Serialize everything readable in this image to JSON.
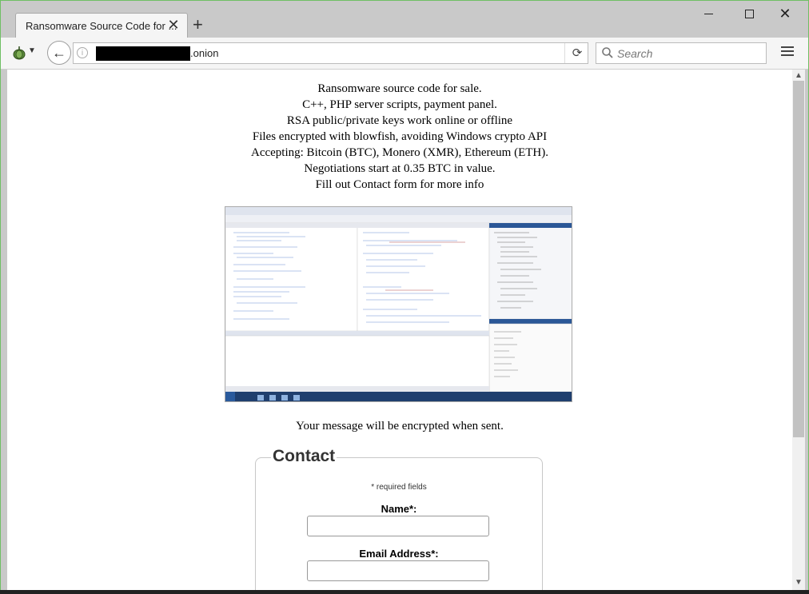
{
  "browser": {
    "tab_title": "Ransomware Source Code for ...",
    "url_suffix": ".onion",
    "search_placeholder": "Search"
  },
  "page": {
    "lines": [
      "Ransomware source code for sale.",
      "C++, PHP server scripts, payment panel.",
      "RSA public/private keys work online or offline",
      "Files encrypted with blowfish, avoiding Windows crypto API",
      "Accepting: Bitcoin (BTC), Monero (XMR), Ethereum (ETH).",
      "Negotiations start at 0.35 BTC in value.",
      "Fill out Contact form for more info"
    ],
    "encrypted_note": "Your message will be encrypted when sent."
  },
  "contact": {
    "legend": "Contact",
    "required_note": "* required fields",
    "name_label": "Name*:",
    "name_value": "",
    "email_label": "Email Address*:",
    "email_value": ""
  }
}
